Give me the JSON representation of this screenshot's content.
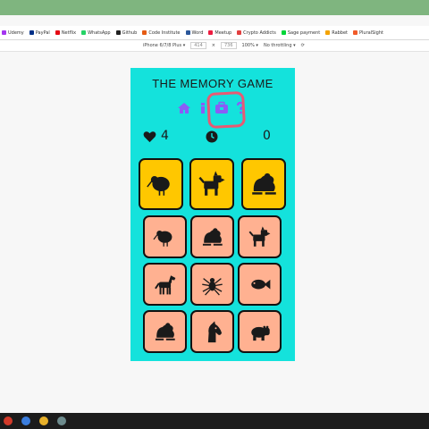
{
  "browser": {
    "bookmarks": [
      {
        "label": "Udemy",
        "color": "#a435f0"
      },
      {
        "label": "PayPal",
        "color": "#003087"
      },
      {
        "label": "Netflix",
        "color": "#e50914"
      },
      {
        "label": "WhatsApp",
        "color": "#25d366"
      },
      {
        "label": "Github",
        "color": "#222222"
      },
      {
        "label": "Code Institute",
        "color": "#e55b13"
      },
      {
        "label": "Word",
        "color": "#2b579a"
      },
      {
        "label": "Meetup",
        "color": "#ed1c40"
      },
      {
        "label": "Crypto Addicts",
        "color": "#e24040"
      },
      {
        "label": "Sage payment",
        "color": "#00d639"
      },
      {
        "label": "Rabbet",
        "color": "#f4a300"
      },
      {
        "label": "PluralSight",
        "color": "#f15b2a"
      }
    ],
    "device_label": "iPhone 6/7/8 Plus ▾",
    "width_value": "414",
    "height_value": "736",
    "zoom_label": "100% ▾",
    "throttling_label": "No throttling ▾"
  },
  "game": {
    "title": "THE MEMORY GAME",
    "lives": "4",
    "score": "0",
    "nav_icons": [
      "home-icon",
      "info-icon",
      "briefcase-icon",
      "question-icon"
    ],
    "target_cards": [
      "kiwi",
      "dog",
      "frog"
    ],
    "grid_cards": [
      [
        "kiwi",
        "frog",
        "dog"
      ],
      [
        "horse",
        "spider",
        "fish"
      ],
      [
        "frog",
        "horse-head",
        "hippo"
      ]
    ],
    "colors": {
      "background": "#14e2dc",
      "target_card": "#ffc700",
      "grid_card": "#ffb191",
      "accent": "#8b5cf6",
      "highlight": "#e85a73"
    }
  }
}
